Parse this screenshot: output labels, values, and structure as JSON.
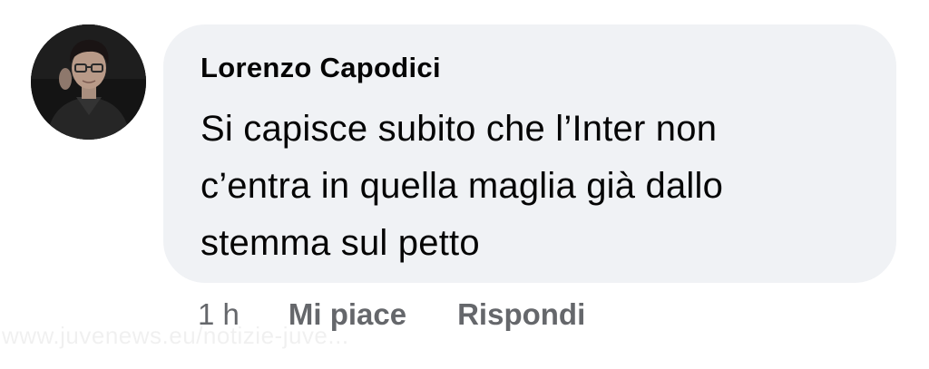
{
  "comment": {
    "author": "Lorenzo Capodici",
    "text_lines": [
      "Si capisce subito che l’Inter non",
      "c’entra in quella maglia già dallo",
      "stemma sul petto"
    ],
    "time": "1 h",
    "like_label": "Mi piace",
    "reply_label": "Rispondi"
  },
  "colors": {
    "bubble_background": "#f0f2f5",
    "text_primary": "#050505",
    "text_secondary": "#65676b"
  },
  "icons": {
    "avatar": "profile-photo"
  },
  "watermark": "www.juvenews.eu/notizie-juve..."
}
